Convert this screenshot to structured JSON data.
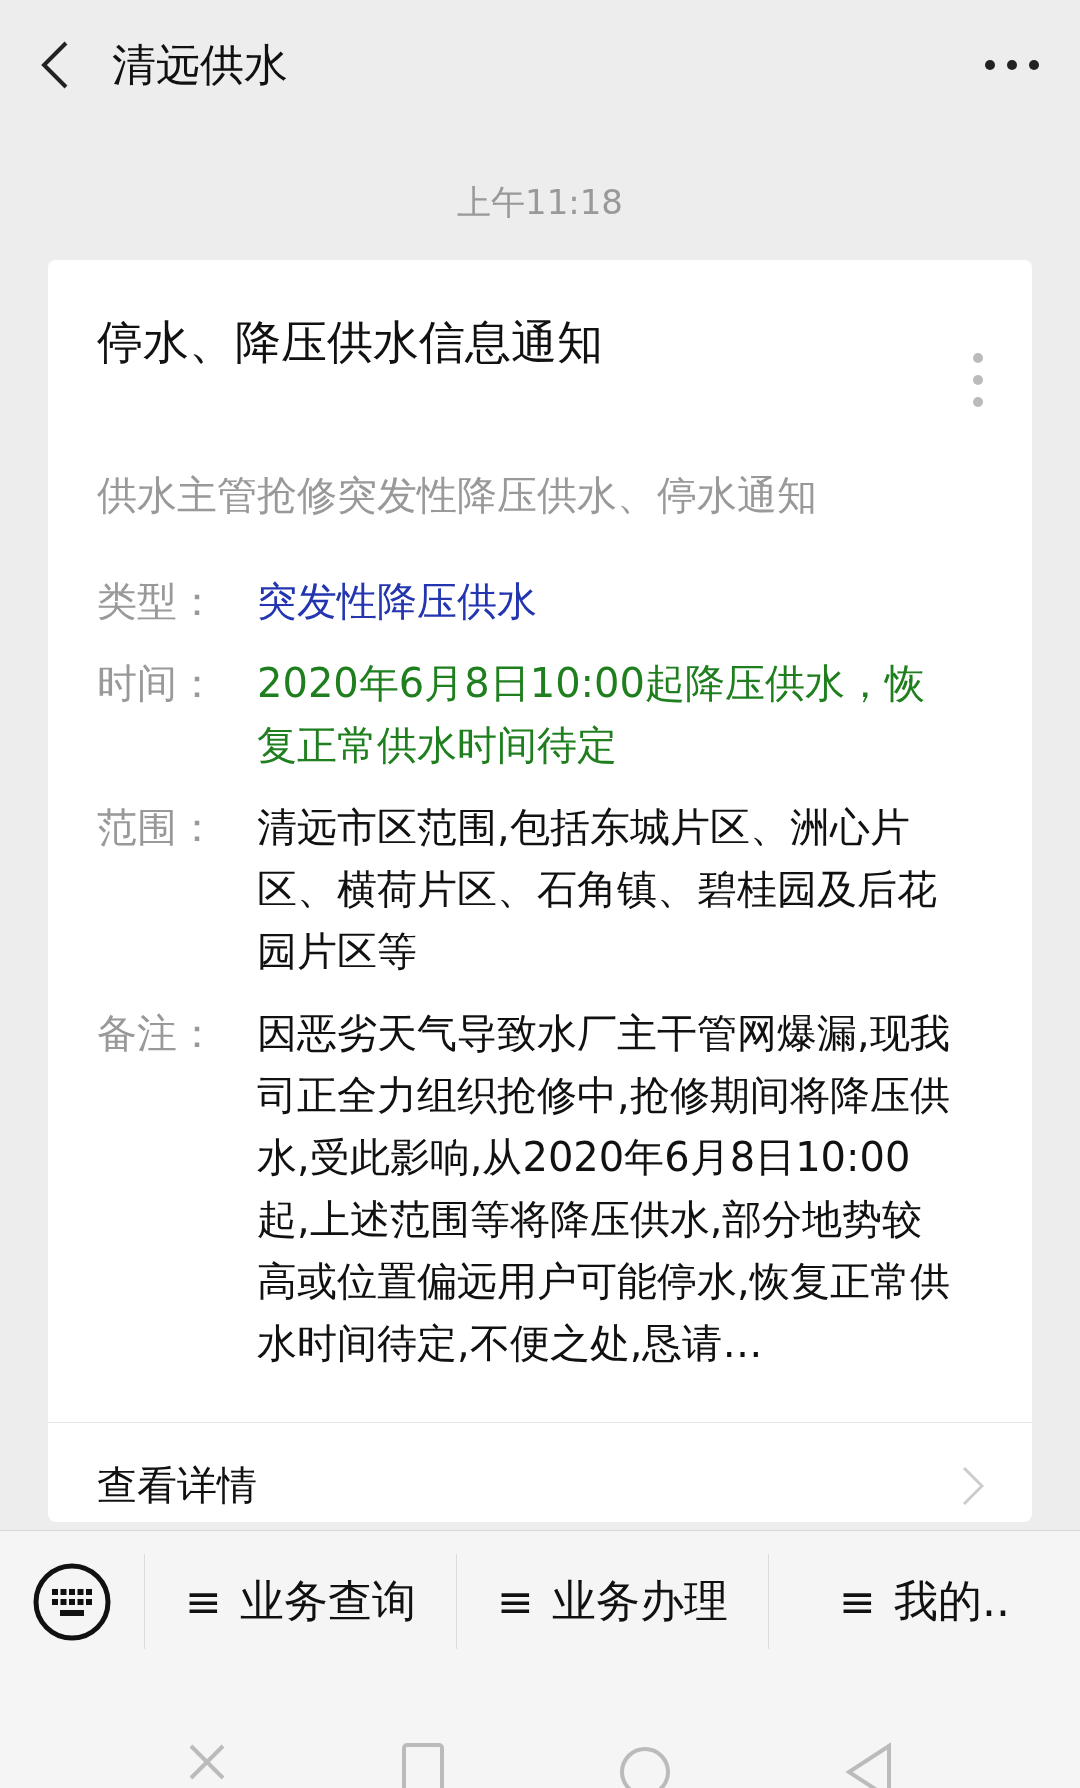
{
  "header": {
    "title": "清远供水"
  },
  "timestamp": "上午11:18",
  "card": {
    "title": "停水、降压供水信息通知",
    "subtitle": "供水主管抢修突发性降压供水、停水通知",
    "fields": [
      {
        "label": "类型：",
        "value": "突发性降压供水",
        "kind": "category"
      },
      {
        "label": "时间：",
        "value": "2020年6月8日10:00起降压供水，恢复正常供水时间待定",
        "kind": "schedule"
      },
      {
        "label": "范围：",
        "value": "清远市区范围,包括东城片区、洲心片区、横荷片区、石角镇、碧桂园及后花园片区等",
        "kind": "text"
      },
      {
        "label": "备注：",
        "value": "因恶劣天气导致水厂主干管网爆漏,现我司正全力组织抢修中,抢修期间将降压供水,受此影响,从2020年6月8日10:00起,上述范围等将降压供水,部分地势较高或位置偏远用户可能停水,恢复正常供水时间待定,不便之处,恳请…",
        "kind": "text"
      }
    ],
    "link": "查看详情"
  },
  "menu_bar": {
    "items": [
      {
        "icon": "≡",
        "label": "业务查询"
      },
      {
        "icon": "≡",
        "label": "业务办理"
      },
      {
        "icon": "≡",
        "label": "我的.."
      }
    ]
  }
}
